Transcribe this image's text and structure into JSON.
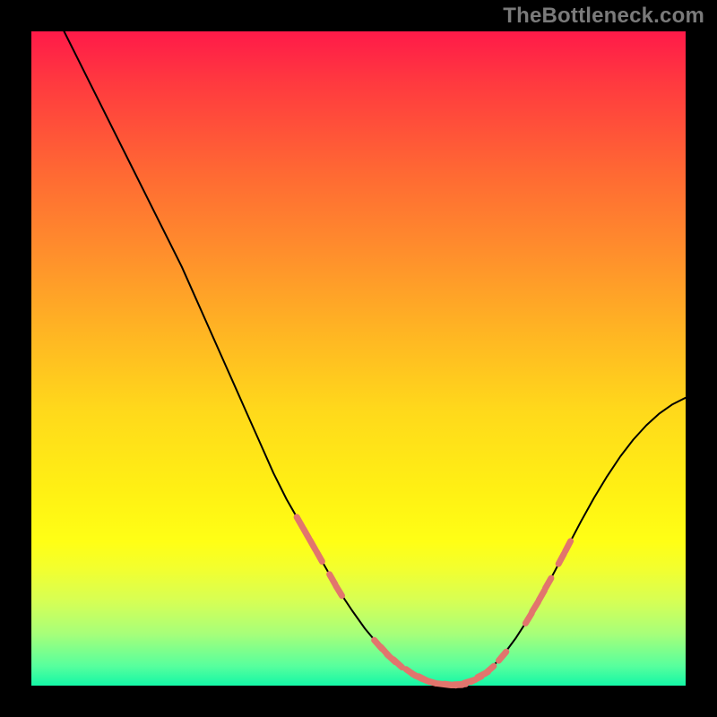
{
  "watermark": "TheBottleneck.com",
  "colors": {
    "background": "#000000",
    "gradient_top": "#ff1a49",
    "gradient_bottom": "#14f7a6",
    "curve": "#000000",
    "points": "#e2756d",
    "watermark": "#7a7a7a"
  },
  "chart_data": {
    "type": "line",
    "title": "",
    "xlabel": "",
    "ylabel": "",
    "xlim": [
      0,
      100
    ],
    "ylim": [
      0,
      100
    ],
    "x": [
      5,
      7,
      9,
      11,
      13,
      15,
      17,
      19,
      21,
      23,
      25,
      27,
      29,
      31,
      33,
      35,
      37,
      39,
      41,
      43,
      45,
      47,
      49,
      51,
      53,
      55,
      57,
      59,
      61,
      63,
      65,
      66,
      68,
      70,
      72,
      74,
      76,
      78,
      80,
      82,
      84,
      86,
      88,
      90,
      92,
      94,
      96,
      98,
      100
    ],
    "y": [
      100,
      96,
      92,
      88,
      84,
      80,
      76,
      72,
      68,
      64,
      59.5,
      55,
      50.5,
      46,
      41.5,
      37,
      32.5,
      28.5,
      25,
      21.5,
      18,
      14.5,
      11.5,
      8.7,
      6.3,
      4.2,
      2.6,
      1.4,
      0.6,
      0.2,
      0.1,
      0.3,
      1.0,
      2.4,
      4.5,
      7.2,
      10.3,
      13.8,
      17.5,
      21.3,
      25.1,
      28.7,
      32.0,
      35.0,
      37.6,
      39.8,
      41.6,
      43.0,
      44.0
    ],
    "highlight_segments": [
      {
        "x": [
          41,
          43,
          45,
          47
        ],
        "y": [
          25,
          21.5,
          18,
          14.5
        ]
      },
      {
        "x": [
          53,
          55,
          57,
          59,
          61,
          63,
          65,
          66,
          68,
          70,
          72
        ],
        "y": [
          6.3,
          4.2,
          2.6,
          1.4,
          0.6,
          0.2,
          0.1,
          0.3,
          1.0,
          2.4,
          4.5
        ]
      },
      {
        "x": [
          76,
          78,
          80,
          82
        ],
        "y": [
          10.3,
          13.8,
          17.5,
          21.3
        ]
      }
    ],
    "annotations": []
  }
}
